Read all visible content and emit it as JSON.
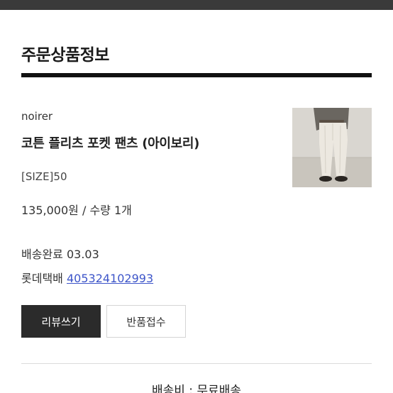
{
  "section": {
    "title": "주문상품정보"
  },
  "product": {
    "brand": "noirer",
    "name": "코튼 플리츠 포켓 팬츠 (아이보리)",
    "size": "[SIZE]50",
    "price_qty": "135,000원 / 수량 1개",
    "image_desc": "product-photo"
  },
  "delivery": {
    "status": "배송완료 03.03",
    "courier": "롯데택배",
    "tracking_number": "405324102993"
  },
  "actions": {
    "review_label": "리뷰쓰기",
    "return_label": "반품접수"
  },
  "footer": {
    "shipping_fee": "배송비 : 무료배송"
  },
  "colors": {
    "link": "#3d55c9",
    "primary_button": "#2b2b2b",
    "rule": "#111111"
  }
}
